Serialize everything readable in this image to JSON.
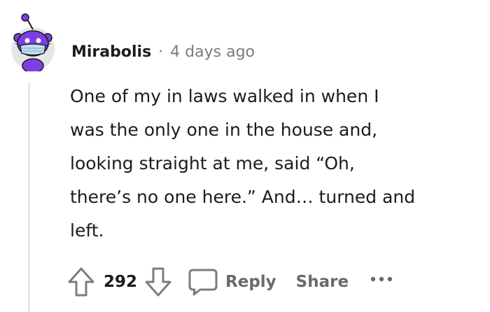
{
  "comment": {
    "username": "Mirabolis",
    "separator": "·",
    "timestamp": "4 days ago",
    "lines": [
      "One of my in laws walked in when I",
      "was the only one in the house and,",
      "looking straight at me, said “Oh,",
      "there’s no one here.” And… turned and",
      "left."
    ]
  },
  "actions": {
    "vote_count": "292",
    "reply_label": "Reply",
    "share_label": "Share"
  },
  "icons": {
    "avatar": "reddit-snoo-mask-avatar",
    "upvote": "arrow-up-icon",
    "downvote": "arrow-down-icon",
    "reply": "speech-bubble-icon",
    "more": "more-dots-icon"
  },
  "colors": {
    "avatar_purple": "#7b3fe4",
    "avatar_bg": "#e6e6e6",
    "text": "#1c1c1c",
    "muted": "#7c7c7c"
  }
}
